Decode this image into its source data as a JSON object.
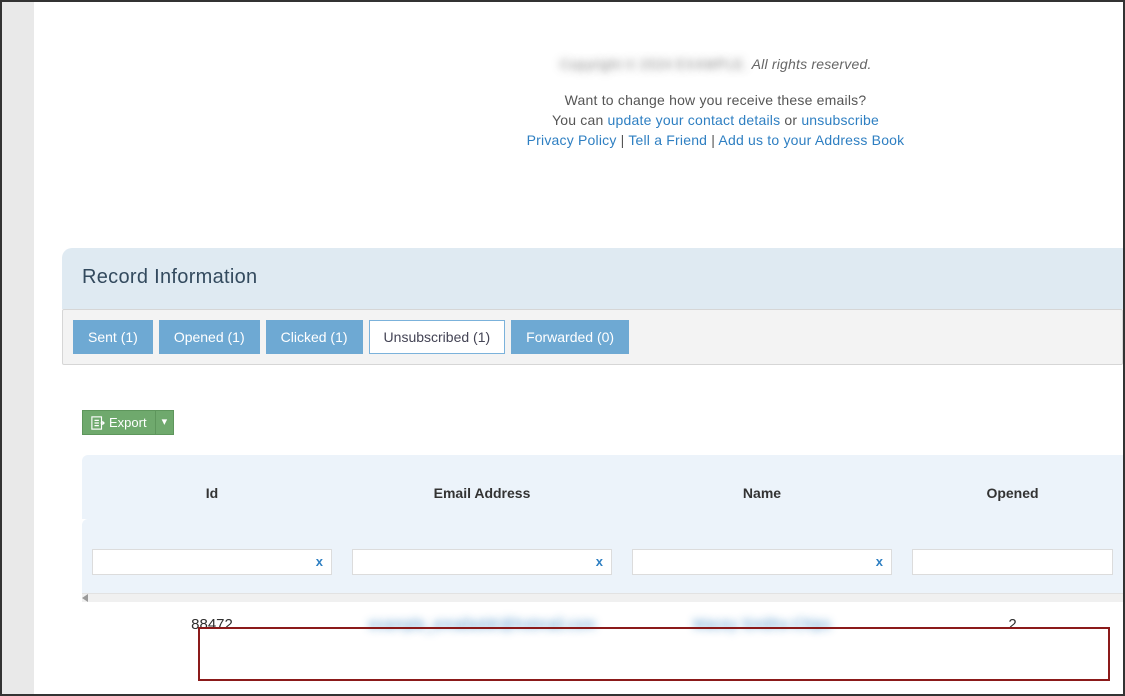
{
  "footer": {
    "copyright_blur": "Copyright © 2024 EXAMPLE.",
    "rights": "All rights reserved.",
    "change_q": "Want to change how you receive these emails?",
    "you_can": "You can ",
    "update_link": "update your contact details",
    "or": " or ",
    "unsubscribe_link": "unsubscribe",
    "privacy": "Privacy Policy",
    "sep": " | ",
    "tell": "Tell a Friend",
    "addus": "Add us to your Address Book"
  },
  "section": {
    "title": "Record Information"
  },
  "tabs": {
    "sent": "Sent (1)",
    "opened": "Opened (1)",
    "clicked": "Clicked (1)",
    "unsubscribed": "Unsubscribed (1)",
    "forwarded": "Forwarded (0)"
  },
  "export": {
    "label": "Export"
  },
  "columns": {
    "id": "Id",
    "email": "Email Address",
    "name": "Name",
    "opened": "Opened"
  },
  "filters": {
    "id": "",
    "email": "",
    "name": "",
    "opened": ""
  },
  "row": {
    "id": "88472",
    "email_blur": "example_emailaddr@hotmail.com",
    "name_blur": "Macey Smiths-Chips",
    "opened": "2"
  },
  "icons": {
    "export": "export-spreadsheet-icon",
    "caret": "▾",
    "clear": "x"
  }
}
